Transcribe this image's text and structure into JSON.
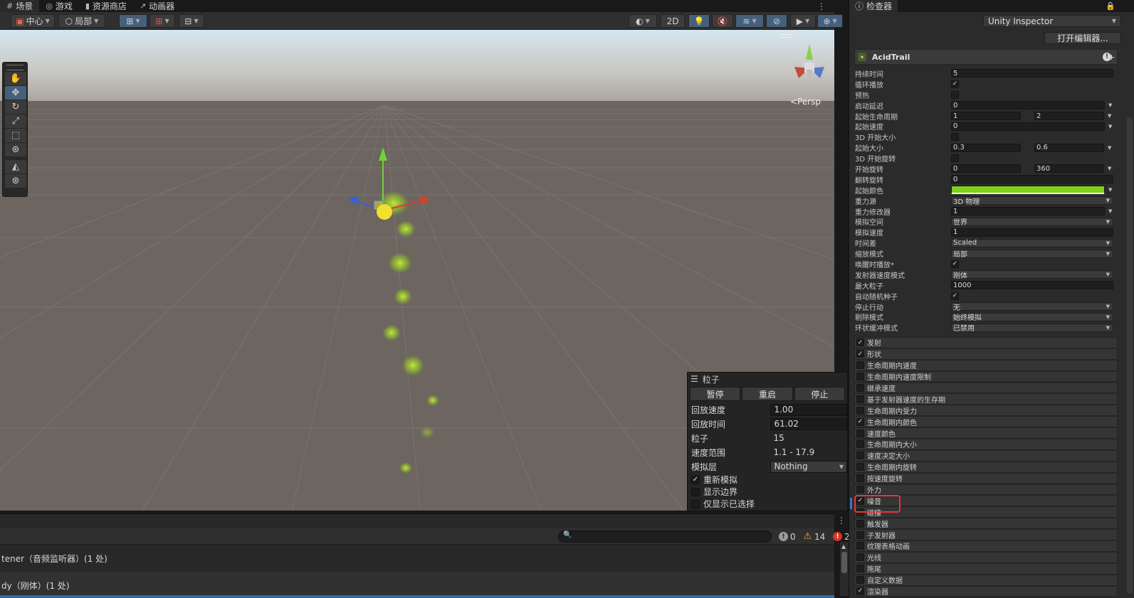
{
  "tabs": [
    {
      "label": "场景",
      "icon": "#"
    },
    {
      "label": "游戏",
      "icon": "◎"
    },
    {
      "label": "资源商店",
      "icon": "▮"
    },
    {
      "label": "动画器",
      "icon": "↗"
    }
  ],
  "toolbar": {
    "pivot": "中心",
    "space": "局部",
    "mode2d": "2D"
  },
  "viewport": {
    "persp_label": "<Persp"
  },
  "particle_panel": {
    "title": "粒子",
    "buttons": [
      "暂停",
      "重启",
      "停止"
    ],
    "rows": [
      {
        "label": "回放速度",
        "value": "1.00"
      },
      {
        "label": "回放时间",
        "value": "61.02"
      },
      {
        "label": "粒子",
        "value": "15"
      },
      {
        "label": "速度范围",
        "value": "1.1 - 17.9"
      },
      {
        "label": "模拟层",
        "value": "Nothing"
      }
    ],
    "checks": [
      {
        "label": "重新模拟",
        "checked": true
      },
      {
        "label": "显示边界",
        "checked": false
      },
      {
        "label": "仅显示已选择",
        "checked": false
      }
    ]
  },
  "console": {
    "search_placeholder": "",
    "counts": {
      "info": "0",
      "warn": "14",
      "error": "2"
    },
    "logs": [
      "tener（音频监听器）(1 处)",
      "dy（刚体）(1 处)"
    ]
  },
  "inspector": {
    "tab_label": "检查器",
    "mode_dropdown": "Unity Inspector",
    "open_editor": "打开编辑器...",
    "component": "AcidTrail",
    "props": [
      {
        "label": "持续时间",
        "type": "field",
        "values": [
          "5"
        ]
      },
      {
        "label": "循环播放",
        "type": "check",
        "checked": true
      },
      {
        "label": "预热",
        "type": "check",
        "checked": false
      },
      {
        "label": "启动延迟",
        "type": "field",
        "values": [
          "0"
        ],
        "dropdown": true
      },
      {
        "label": "起始生命周期",
        "type": "range",
        "values": [
          "1",
          "2"
        ],
        "dropdown": true
      },
      {
        "label": "起始速度",
        "type": "field",
        "values": [
          "0"
        ],
        "dropdown": true
      },
      {
        "label": "3D 开始大小",
        "type": "check",
        "checked": false
      },
      {
        "label": "起始大小",
        "type": "range",
        "values": [
          "0.3",
          "0.6"
        ],
        "dropdown": true
      },
      {
        "label": "3D 开始旋转",
        "type": "check",
        "checked": false
      },
      {
        "label": "开始旋转",
        "type": "range",
        "values": [
          "0",
          "360"
        ],
        "dropdown": true
      },
      {
        "label": "翻转旋转",
        "type": "field",
        "values": [
          "0"
        ]
      },
      {
        "label": "起始颜色",
        "type": "color",
        "color": "#7fd11b",
        "dropdown": true
      },
      {
        "label": "重力源",
        "type": "select",
        "values": [
          "3D 物理"
        ]
      },
      {
        "label": "重力修改器",
        "type": "field",
        "values": [
          "1"
        ],
        "dropdown": true
      },
      {
        "label": "模拟空间",
        "type": "select",
        "values": [
          "世界"
        ]
      },
      {
        "label": "模拟速度",
        "type": "field",
        "values": [
          "1"
        ]
      },
      {
        "label": "时间差",
        "type": "select",
        "values": [
          "Scaled"
        ]
      },
      {
        "label": "缩放模式",
        "type": "select",
        "values": [
          "局部"
        ]
      },
      {
        "label": "唤醒时播放*",
        "type": "check",
        "checked": true
      },
      {
        "label": "发射器速度模式",
        "type": "select",
        "values": [
          "刚体"
        ]
      },
      {
        "label": "最大粒子",
        "type": "field",
        "values": [
          "1000"
        ]
      },
      {
        "label": "自动随机种子",
        "type": "check",
        "checked": true
      },
      {
        "label": "停止行动",
        "type": "select",
        "values": [
          "无"
        ]
      },
      {
        "label": "剔除模式",
        "type": "select",
        "values": [
          "始终模拟"
        ]
      },
      {
        "label": "环状缓冲模式",
        "type": "select",
        "values": [
          "已禁用"
        ]
      }
    ],
    "modules": [
      {
        "label": "发射",
        "checked": true
      },
      {
        "label": "形状",
        "checked": true
      },
      {
        "label": "生命周期内速度",
        "checked": false
      },
      {
        "label": "生命周期内速度限制",
        "checked": false
      },
      {
        "label": "继承速度",
        "checked": false
      },
      {
        "label": "基于发射器速度的生存期",
        "checked": false
      },
      {
        "label": "生命周期内受力",
        "checked": false
      },
      {
        "label": "生命周期内颜色",
        "checked": true
      },
      {
        "label": "速度颜色",
        "checked": false
      },
      {
        "label": "生命周期内大小",
        "checked": false
      },
      {
        "label": "速度决定大小",
        "checked": false
      },
      {
        "label": "生命周期内旋转",
        "checked": false
      },
      {
        "label": "按速度旋转",
        "checked": false
      },
      {
        "label": "外力",
        "checked": false
      },
      {
        "label": "噪音",
        "checked": true
      },
      {
        "label": "碰撞",
        "checked": false
      },
      {
        "label": "触发器",
        "checked": false
      },
      {
        "label": "子发射器",
        "checked": false
      },
      {
        "label": "纹理表格动画",
        "checked": false
      },
      {
        "label": "光线",
        "checked": false
      },
      {
        "label": "拖尾",
        "checked": false
      },
      {
        "label": "自定义数据",
        "checked": false
      },
      {
        "label": "渲染器",
        "checked": true
      }
    ]
  },
  "colors": {
    "accent": "#46607c",
    "highlight_box": "#e5363a",
    "particle_green": "#8fd12a"
  }
}
